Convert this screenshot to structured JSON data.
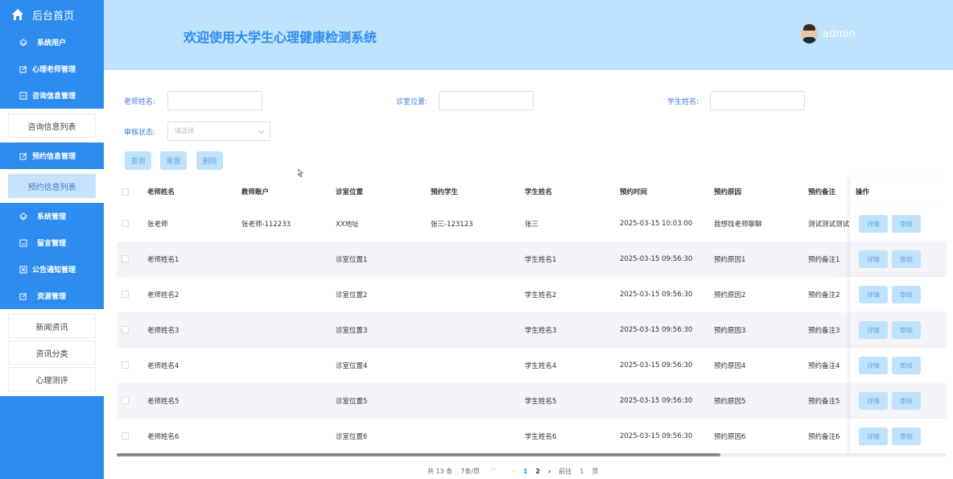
{
  "sidebar": {
    "home_label": "后台首页",
    "items": [
      {
        "label": "系统用户",
        "icon": "layers-icon"
      },
      {
        "label": "心理老师管理",
        "icon": "edit-icon"
      },
      {
        "label": "咨询信息管理",
        "icon": "form-icon"
      },
      {
        "label": "咨询信息列表"
      },
      {
        "label": "预约信息管理",
        "icon": "edit-icon"
      },
      {
        "label": "预约信息列表"
      },
      {
        "label": "系统管理",
        "icon": "layers-icon"
      },
      {
        "label": "留言管理",
        "icon": "message-icon"
      },
      {
        "label": "公告通知管理",
        "icon": "notice-icon"
      },
      {
        "label": "资源管理",
        "icon": "edit-icon"
      },
      {
        "label": "新闻资讯"
      },
      {
        "label": "资讯分类"
      },
      {
        "label": "心理测评"
      }
    ]
  },
  "header": {
    "title": "欢迎使用大学生心理健康检测系统",
    "username": "admin"
  },
  "search": {
    "teacher_label": "老师姓名:",
    "room_label": "诊室位置:",
    "student_label": "学生姓名:",
    "status_label": "审核状态:",
    "status_placeholder": "请选择",
    "query_label": "查询",
    "reset_label": "重置",
    "delete_label": "删除"
  },
  "table": {
    "headers": [
      "老师姓名",
      "教师账户",
      "诊室位置",
      "预约学生",
      "学生姓名",
      "预约时间",
      "预约原因",
      "预约备注",
      "操作"
    ],
    "detail_label": "详情",
    "audit_label": "审核",
    "rows": [
      [
        "张老师",
        "张老师-112233",
        "XX地址",
        "张三-123123",
        "张三",
        "2025-03-15 10:03:00",
        "我想找老师聊聊",
        "测试测试测试"
      ],
      [
        "老师姓名1",
        "",
        "诊室位置1",
        "",
        "学生姓名1",
        "2025-03-15 09:56:30",
        "预约原因1",
        "预约备注1"
      ],
      [
        "老师姓名2",
        "",
        "诊室位置2",
        "",
        "学生姓名2",
        "2025-03-15 09:56:30",
        "预约原因2",
        "预约备注2"
      ],
      [
        "老师姓名3",
        "",
        "诊室位置3",
        "",
        "学生姓名3",
        "2025-03-15 09:56:30",
        "预约原因3",
        "预约备注3"
      ],
      [
        "老师姓名4",
        "",
        "诊室位置4",
        "",
        "学生姓名4",
        "2025-03-15 09:56:30",
        "预约原因4",
        "预约备注4"
      ],
      [
        "老师姓名5",
        "",
        "诊室位置5",
        "",
        "学生姓名5",
        "2025-03-15 09:56:30",
        "预约原因5",
        "预约备注5"
      ],
      [
        "老师姓名6",
        "",
        "诊室位置6",
        "",
        "学生姓名6",
        "2025-03-15 09:56:30",
        "预约原因6",
        "预约备注6"
      ]
    ]
  },
  "pager": {
    "total": "共 13 条",
    "page_size": "7条/页",
    "pages": [
      "1",
      "2"
    ],
    "current_page": "2",
    "goto_label": "前往",
    "goto_value": "1",
    "page_suffix": "页"
  },
  "colors": {
    "sidebar": "#2d8cf0",
    "header": "#bfe2fd",
    "accent": "#2d8cf0"
  }
}
